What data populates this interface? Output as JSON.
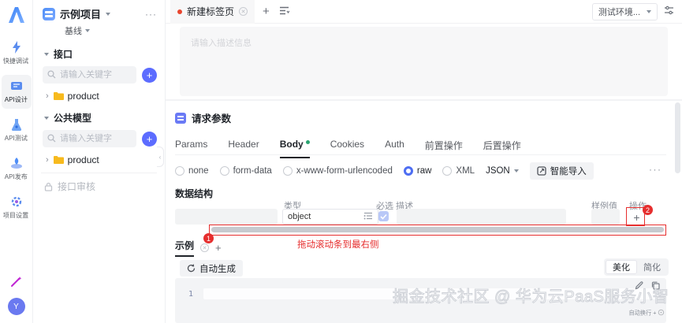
{
  "rail": {
    "items": [
      {
        "label": "快捷调试"
      },
      {
        "label": "API设计"
      },
      {
        "label": "API测试"
      },
      {
        "label": "API发布"
      },
      {
        "label": "项目设置"
      }
    ],
    "avatar_initial": "Y"
  },
  "sidebar": {
    "project": {
      "name": "示例项目",
      "branch": "基线",
      "more": "···"
    },
    "sections": [
      {
        "title": "接口",
        "search_placeholder": "请输入关键字",
        "item": "product"
      },
      {
        "title": "公共模型",
        "search_placeholder": "请输入关键字",
        "item": "product"
      }
    ],
    "review_label": "接口审核"
  },
  "topbar": {
    "tab_label": "新建标签页",
    "env_label": "测试环境..."
  },
  "doc": {
    "placeholder": "请输入描述信息"
  },
  "request": {
    "title": "请求参数",
    "tabs": [
      {
        "label": "Params"
      },
      {
        "label": "Header"
      },
      {
        "label": "Body"
      },
      {
        "label": "Cookies"
      },
      {
        "label": "Auth"
      },
      {
        "label": "前置操作"
      },
      {
        "label": "后置操作"
      }
    ],
    "body_types": [
      {
        "label": "none"
      },
      {
        "label": "form-data"
      },
      {
        "label": "x-www-form-urlencoded"
      },
      {
        "label": "raw"
      },
      {
        "label": "XML"
      }
    ],
    "raw_format": "JSON",
    "import_button": "智能导入",
    "more": "···"
  },
  "schema": {
    "title": "数据结构",
    "columns": {
      "type": "类型",
      "required": "必选",
      "description": "描述",
      "example": "样例值",
      "operation": "操作"
    },
    "row": {
      "type": "object",
      "required": true,
      "add": "+"
    }
  },
  "annotations": {
    "step1": "1",
    "step2": "2",
    "hint": "拖动滚动条到最右侧"
  },
  "example": {
    "tab": "示例",
    "add": "+",
    "generate": "自动生成",
    "beautify": "美化",
    "simplify": "简化",
    "line_number": "1",
    "wrap_hint": "自动换行 +"
  },
  "watermark": "掘金技术社区 @ 华为云PaaS服务小智",
  "colors": {
    "accent": "#4e6ef2",
    "annotation": "#e62e2e",
    "body_dot": "#2ba471",
    "folder": "#f7ba1e"
  }
}
